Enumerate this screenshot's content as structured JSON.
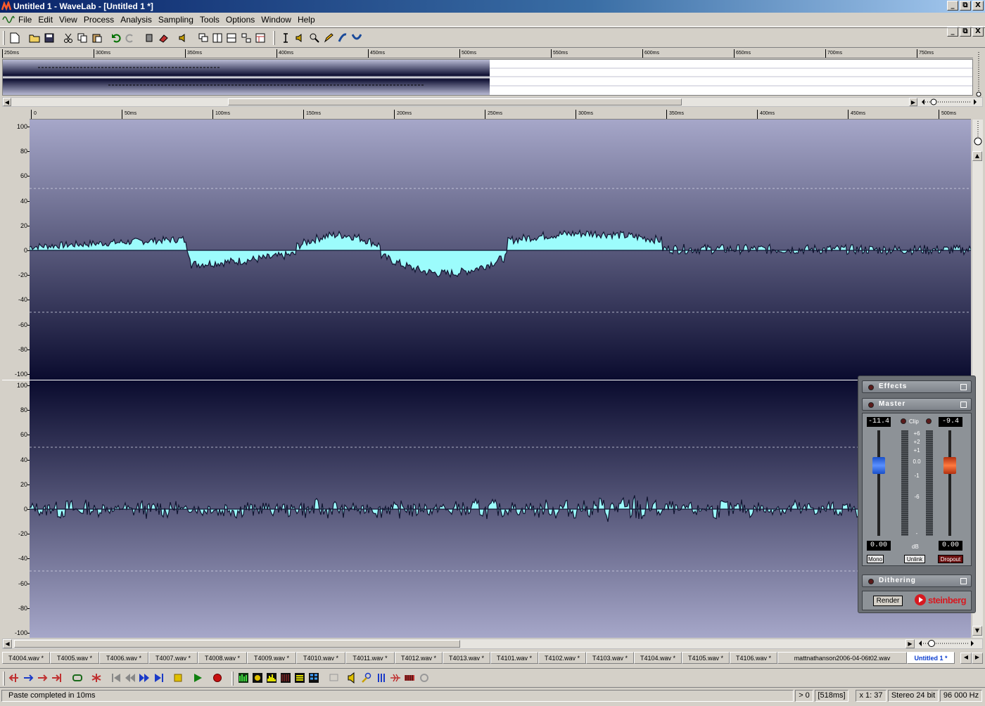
{
  "window": {
    "title": "Untitled 1 - WaveLab - [Untitled 1 *]",
    "buttons": [
      "_",
      "⧉",
      "X"
    ]
  },
  "menu": [
    "File",
    "Edit",
    "View",
    "Process",
    "Analysis",
    "Sampling",
    "Tools",
    "Options",
    "Window",
    "Help"
  ],
  "overview_ruler": [
    "250ms",
    "300ms",
    "350ms",
    "400ms",
    "450ms",
    "500ms",
    "550ms",
    "600ms",
    "650ms",
    "700ms",
    "750ms"
  ],
  "time_ruler": [
    "0",
    "50ms",
    "100ms",
    "150ms",
    "200ms",
    "250ms",
    "300ms",
    "350ms",
    "400ms",
    "450ms",
    "500ms"
  ],
  "level_labels": [
    "100",
    "80",
    "60",
    "40",
    "20",
    "0",
    "-20",
    "-40",
    "-60",
    "-80",
    "-100"
  ],
  "colors": {
    "wave_fill": "#9cfcfc",
    "wave_outline": "#101430",
    "bg_light": "#a6a7c9",
    "bg_dark": "#0a0b2e"
  },
  "master": {
    "effects_label": "Effects",
    "master_label": "Master",
    "dithering_label": "Dithering",
    "left_peak": "-11.4",
    "right_peak": "-9.4",
    "clip_label": "Clip",
    "scale": [
      "+6",
      "+2",
      "+1",
      "0.0",
      "-1",
      "-6",
      "-"
    ],
    "db_label": "dB",
    "left_gain": "0.00",
    "right_gain": "0.00",
    "mono_label": "Mono",
    "unlink_label": "Unlink",
    "dropout_label": "Dropout",
    "render_label": "Render",
    "brand": "steinberg"
  },
  "tabs": [
    "T4004.wav *",
    "T4005.wav *",
    "T4006.wav *",
    "T4007.wav *",
    "T4008.wav *",
    "T4009.wav *",
    "T4010.wav *",
    "T4011.wav *",
    "T4012.wav *",
    "T4013.wav *",
    "T4101.wav *",
    "T4102.wav *",
    "T4103.wav *",
    "T4104.wav *",
    "T4105.wav *",
    "T4106.wav *",
    "mattnathanson2006-04-06t02.wav",
    "Untitled 1 *"
  ],
  "status": {
    "message": "Paste completed in 10ms",
    "cursor": "> 0",
    "length": "[518ms]",
    "zoom": "x 1: 37",
    "format": "Stereo 24 bit",
    "rate": "96 000 Hz"
  }
}
